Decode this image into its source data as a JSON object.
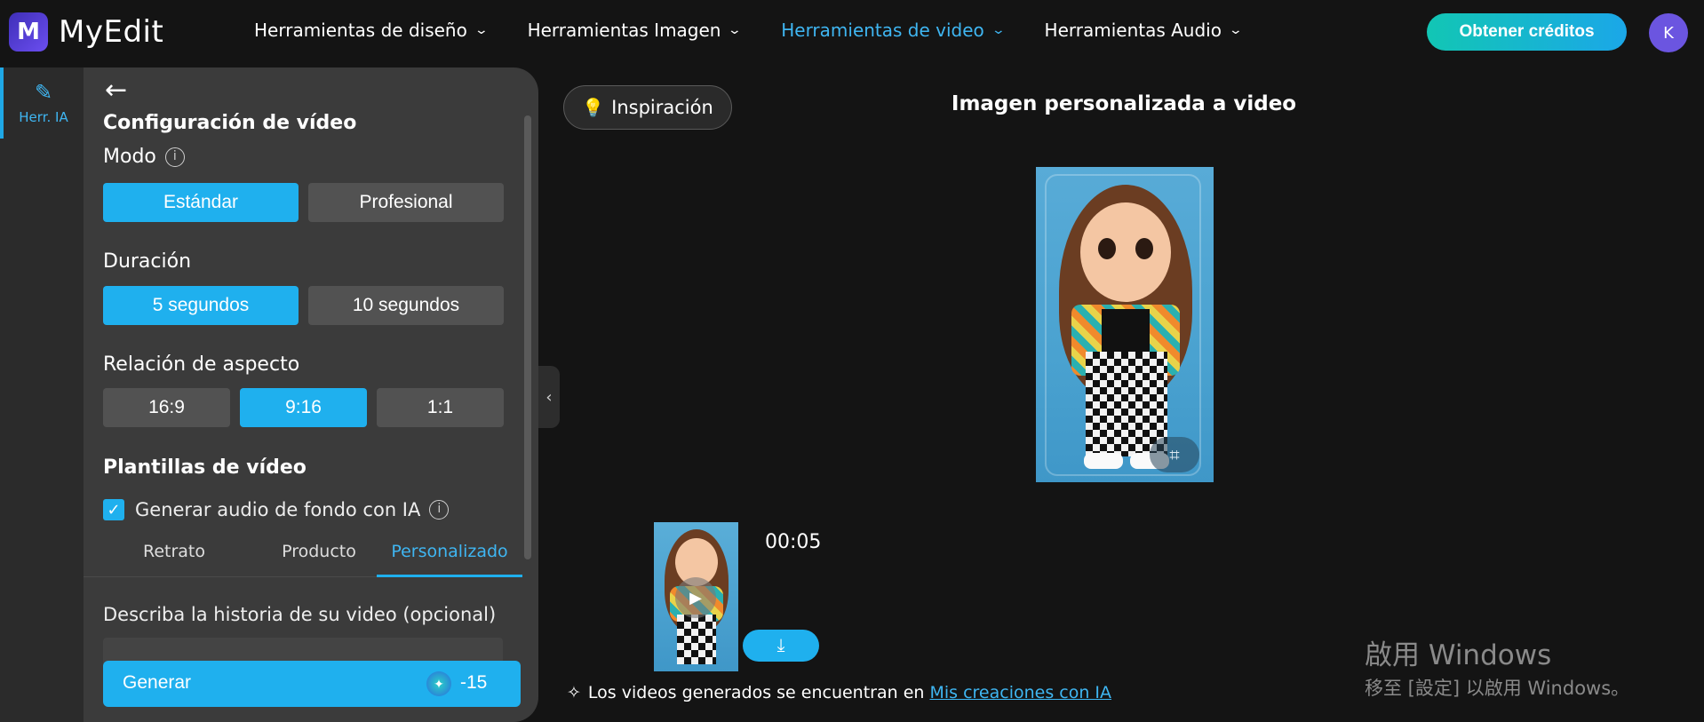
{
  "app": {
    "logo_letter": "M",
    "name": "MyEdit",
    "brand_color": "#4b37d0",
    "accent_color": "#1fb0ee"
  },
  "nav": {
    "items": [
      {
        "label": "Herramientas de diseño",
        "active": false
      },
      {
        "label": "Herramientas Imagen",
        "active": false
      },
      {
        "label": "Herramientas de video",
        "active": true
      },
      {
        "label": "Herramientas Audio",
        "active": false
      }
    ],
    "credits_button": "Obtener créditos",
    "avatar_initial": "K"
  },
  "rail": {
    "item_icon": "magic-wand-icon",
    "item_label": "Herr. IA"
  },
  "panel": {
    "section_title": "Configuración de vídeo",
    "mode_label": "Modo",
    "mode_options": [
      "Estándar",
      "Profesional"
    ],
    "mode_selected": "Estándar",
    "duration_label": "Duración",
    "duration_options": [
      "5 segundos",
      "10 segundos"
    ],
    "duration_selected": "5 segundos",
    "aspect_label": "Relación de aspecto",
    "aspect_options": [
      "16:9",
      "9:16",
      "1:1"
    ],
    "aspect_selected": "9:16",
    "templates_title": "Plantillas de vídeo",
    "bg_audio_label": "Generar audio de fondo con IA",
    "bg_audio_checked": true,
    "template_tabs": [
      "Retrato",
      "Producto",
      "Personalizado"
    ],
    "template_tab_active": "Personalizado",
    "story_label": "Describa la historia de su video (opcional)",
    "generate_label": "Generar",
    "generate_cost": "-15"
  },
  "main": {
    "inspiration_button": "Inspiración",
    "title": "Imagen personalizada a video",
    "result_duration": "00:05",
    "footer_text": "Los videos generados se encuentran en ",
    "footer_link": "Mis creaciones con IA"
  },
  "watermark": {
    "line1": "啟用 Windows",
    "line2": "移至 [設定] 以啟用 Windows。"
  }
}
